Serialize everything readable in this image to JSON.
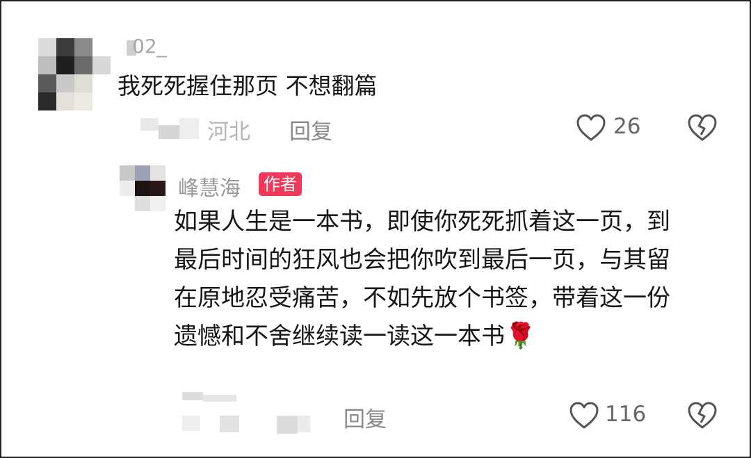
{
  "comment": {
    "username_partial": "02_",
    "text": "我死死握住那页 不想翻篇",
    "location_partial": "河北",
    "reply_label": "回复",
    "like_count": "26"
  },
  "reply": {
    "author_name_partial": "峰慧海",
    "author_badge": "作者",
    "text": "如果人生是一本书，即使你死死抓着这一页，到最后时间的狂风也会把你吹到最后一页，与其留在原地忍受痛苦，不如先放个书签，带着这一份遗憾和不舍继续读一读这一本书",
    "emoji": "🌹",
    "reply_label": "回复",
    "like_count": "116"
  },
  "icons": {
    "like": "heart-outline-icon",
    "dislike": "broken-heart-icon"
  },
  "colors": {
    "author_badge_bg": "#f0385a",
    "meta_text": "#8a8a8a",
    "body_text": "#161616"
  }
}
